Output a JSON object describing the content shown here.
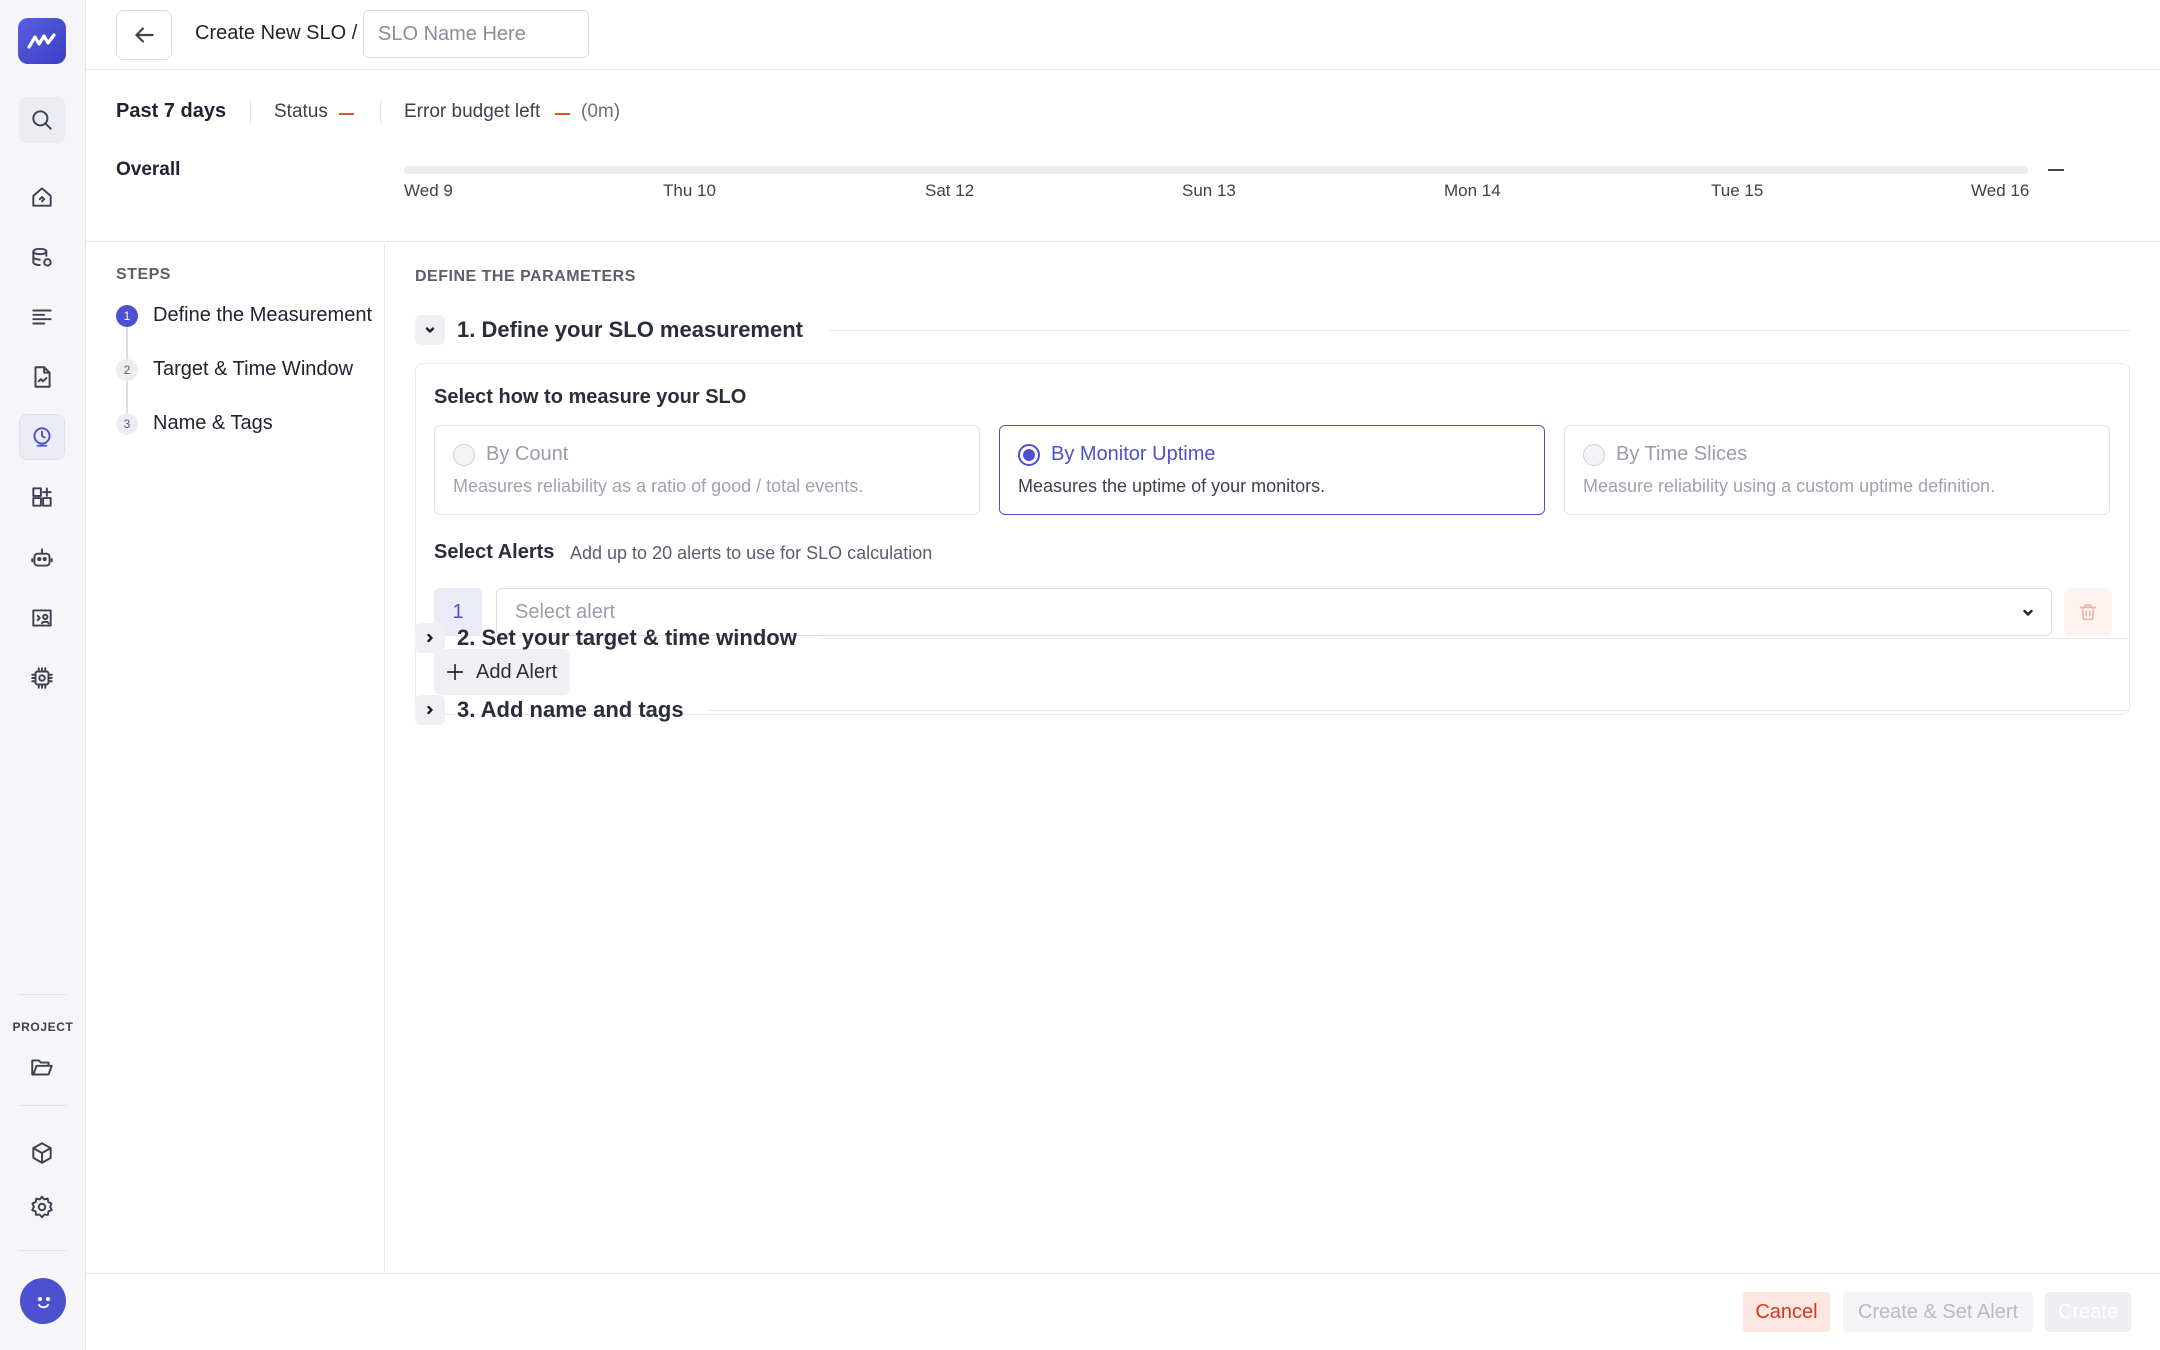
{
  "rail": {
    "project_label": "PROJECT",
    "icons": [
      "logo-icon",
      "search-icon",
      "home-icon",
      "database-icon",
      "logs-icon",
      "document-icon",
      "slo-icon",
      "dashboards-icon",
      "robot-icon",
      "monitor-icon",
      "chip-icon",
      "folder-icon",
      "package-icon",
      "settings-icon",
      "avatar"
    ]
  },
  "header": {
    "breadcrumb": "Create New SLO /",
    "name_placeholder": "SLO Name Here"
  },
  "summary": {
    "period": "Past 7 days",
    "status_label": "Status",
    "budget_label": "Error budget left",
    "budget_value": "(0m)",
    "overall_label": "Overall",
    "timeline_ticks": [
      "Wed 9",
      "Thu 10",
      "Sat 12",
      "Sun 13",
      "Mon 14",
      "Tue 15",
      "Wed 16"
    ]
  },
  "steps": {
    "title": "STEPS",
    "items": [
      {
        "num": "1",
        "label": "Define the Measurement"
      },
      {
        "num": "2",
        "label": "Target & Time Window"
      },
      {
        "num": "3",
        "label": "Name & Tags"
      }
    ]
  },
  "main": {
    "section_title": "DEFINE THE PARAMETERS",
    "accordions": [
      {
        "title": "1. Define your SLO measurement"
      },
      {
        "title": "2. Set your target & time window"
      },
      {
        "title": "3. Add name and tags"
      }
    ],
    "measure_label": "Select how to measure your SLO",
    "options": [
      {
        "title": "By Count",
        "desc": "Measures reliability as a ratio of good / total events."
      },
      {
        "title": "By Monitor Uptime",
        "desc": "Measures the uptime of your monitors."
      },
      {
        "title": "By Time Slices",
        "desc": "Measure reliability using a custom uptime definition."
      }
    ],
    "selected_option": "By Monitor Uptime",
    "alerts_label": "Select Alerts",
    "alerts_hint": "Add up to 20 alerts to use for SLO calculation",
    "alert_index": "1",
    "alert_placeholder": "Select alert",
    "add_alert_label": "Add Alert"
  },
  "footer": {
    "cancel_label": "Cancel",
    "create_set_alert_label": "Create & Set Alert",
    "create_label": "Create"
  },
  "colors": {
    "accent": "#4d51cf",
    "danger": "#d23a1e",
    "status_dash": "#e0512f"
  }
}
